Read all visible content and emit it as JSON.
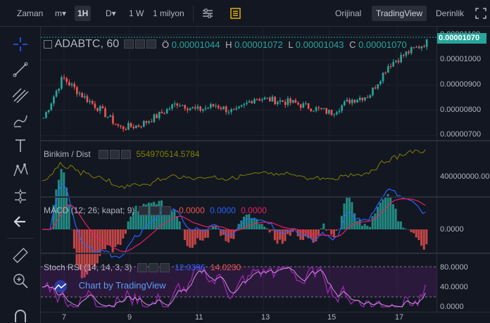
{
  "toolbar": {
    "time_label": "Zaman",
    "interval_m": "m▾",
    "interval_active": "1H",
    "chart_type": "D▾",
    "range_1w": "1 W",
    "range_1m": "1 milyon",
    "view_original": "Orijinal",
    "view_tradingview": "TradingView",
    "view_depth": "Derinlik"
  },
  "symbol": {
    "name": "ADABTC, 60",
    "o_label": "Ö",
    "o_value": "0.00001044",
    "h_label": "H",
    "h_value": "0.00001072",
    "l_label": "L",
    "l_value": "0.00001043",
    "c_label": "C",
    "c_value": "0.00001070"
  },
  "price_axis": {
    "labels": [
      "0.00001100",
      "0.00001000",
      "0.00000900",
      "0.00000800",
      "0.00000700"
    ],
    "current_price": "0.00001070"
  },
  "indicators": {
    "accum": {
      "name": "Birikim / Dist",
      "value": "554970514.5784",
      "axis_label": "400000000.00"
    },
    "macd": {
      "name": "MACD (12; 26; kapat; 9)",
      "v1": "-0.0000",
      "v2": "0.0000",
      "v3": "0.0000",
      "axis_label": "0.0000"
    },
    "stoch": {
      "name": "Stoch RSI (14, 14, 3, 3)",
      "v1": "12.0396",
      "v2": "14.0230",
      "axis_labels": [
        "80.0000",
        "40.0000",
        "0.0000"
      ]
    }
  },
  "watermark": "Chart by TradingView",
  "time_axis": [
    "7",
    "9",
    "11",
    "13",
    "15",
    "17"
  ],
  "colors": {
    "up": "#26a69a",
    "down": "#ef5350",
    "accum": "#808000",
    "macd_line": "#2962ff",
    "signal_line": "#e91e63",
    "stoch_k": "#9c27b0",
    "background": "#131722"
  },
  "chart_data": [
    {
      "type": "candlestick",
      "title": "ADABTC, 60",
      "ylim": [
        6.9e-06,
        1.11e-05
      ],
      "close_approx": [
        7.7e-06,
        9.3e-06,
        8.6e-06,
        8e-06,
        7.3e-06,
        7.4e-06,
        7.8e-06,
        8.3e-06,
        8e-06,
        8.2e-06,
        7.9e-06,
        8.5e-06,
        8.4e-06,
        8.3e-06,
        8.1e-06,
        7.9e-06,
        8.4e-06,
        8.6e-06,
        9.8e-06,
        1.03e-05,
        1.07e-05
      ]
    }
  ]
}
